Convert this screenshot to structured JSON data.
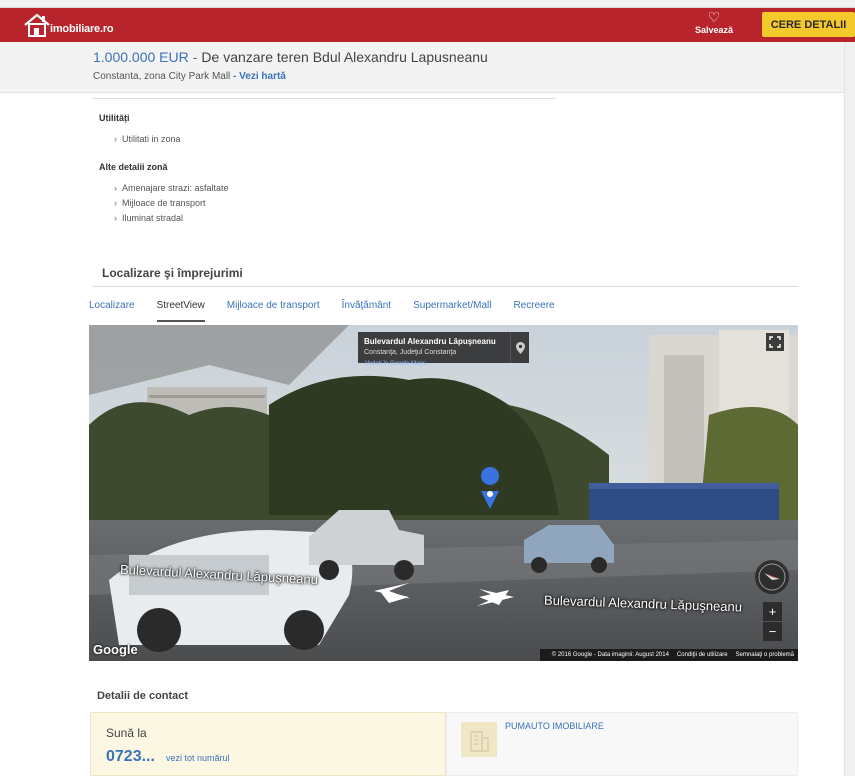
{
  "header": {
    "logo_text": "imobiliare.ro",
    "save_label": "Salvează",
    "cta_label": "CERE DETALII"
  },
  "listing": {
    "price": "1.000.000 EUR",
    "separator": "-",
    "title": "De vanzare teren Bdul Alexandru Lapusneanu",
    "location": "Constanta, zona City Park Mall",
    "location_sep": " - ",
    "map_link": "Vezi hartă"
  },
  "details": {
    "utilities_title": "Utilități",
    "utilities": [
      "Utilitati in zona"
    ],
    "zone_title": "Alte detalii zonă",
    "zone_items": [
      "Amenajare strazi: asfaltate",
      "Mijloace de transport",
      "Iluminat stradal"
    ]
  },
  "surroundings": {
    "title": "Localizare şi împrejurimi",
    "tabs": [
      {
        "label": "Localizare",
        "active": false
      },
      {
        "label": "StreetView",
        "active": true
      },
      {
        "label": "Mijloace de transport",
        "active": false
      },
      {
        "label": "Învăţământ",
        "active": false
      },
      {
        "label": "Supermarket/Mall",
        "active": false
      },
      {
        "label": "Recreere",
        "active": false
      }
    ]
  },
  "streetview": {
    "info_title": "Bulevardul Alexandru Lăpuşneanu",
    "info_subtitle": "Constanţa, Judeţul Constanţa",
    "google_maps_link": "Vedeţi în Google Maps",
    "street_label_left": "Bulevardul Alexandru Lăpuşneanu",
    "street_label_right": "Bulevardul Alexandru Lăpuşneanu",
    "google_logo": "Google",
    "copyright": "© 2016 Google - Data imaginii: August 2014",
    "terms": "Condiţii de utilizare",
    "report": "Semnalaţi o problemă",
    "zoom_in": "+",
    "zoom_out": "−"
  },
  "contact": {
    "title": "Detalii de contact",
    "call_label": "Sună la",
    "phone": "0723...",
    "see_number": "vezi tot numărul",
    "agency": "PUMAUTO IMOBILIARE"
  },
  "colors": {
    "brand_red": "#b8242b",
    "cta_yellow": "#f4c92b",
    "link_blue": "#3a73b8"
  }
}
